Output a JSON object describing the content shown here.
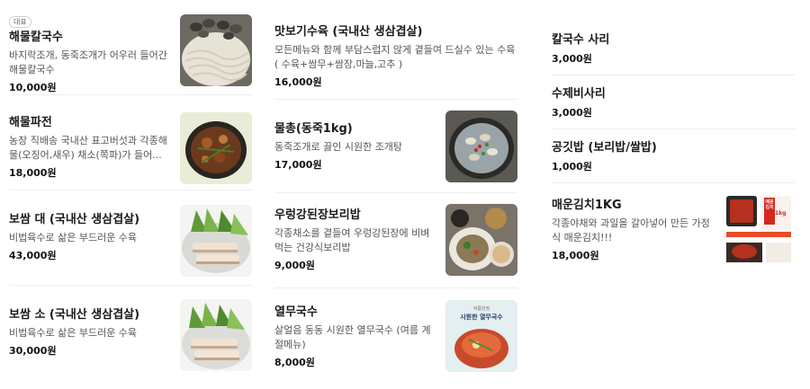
{
  "menu": {
    "col1": [
      {
        "badge": "대표",
        "name": "해물칼국수",
        "desc": "바지락조개, 동죽조개가 어우러 들어간 해물칼국수",
        "price": "10,000원",
        "thumb": "clam-noodle-photo"
      },
      {
        "name": "해물파전",
        "desc": "농장 직배송 국내산 표고버섯과 각종해물(오징어,새우) 채소(쪽파)가 들어...",
        "price": "18,000원",
        "thumb": "seafood-pancake-photo"
      },
      {
        "name": "보쌈 대 (국내산 생삼겹살)",
        "desc": "비법육수로 삶은 부드러운 수육",
        "price": "43,000원",
        "thumb": "bossam-large-photo"
      },
      {
        "name": "보쌈 소 (국내산 생삼겹살)",
        "desc": "비법육수로 삶은 부드러운 수육",
        "price": "30,000원",
        "thumb": "bossam-small-photo"
      }
    ],
    "col2": [
      {
        "name": "맛보기수육 (국내산 생삼겹살)",
        "desc": "모든메뉴와 함께 부담스럽지 않게 곁들여 드실수 있는 수육( 수육+쌈무+쌈장,마늘,고추 )",
        "price": "16,000원"
      },
      {
        "name": "물총(동죽1kg)",
        "desc": "동죽조개로 끓인 시원한 조개탕",
        "price": "17,000원",
        "thumb": "clam-soup-photo"
      },
      {
        "name": "우렁강된장보리밥",
        "desc": "각종채소를 곁들여 우렁강된장에 비벼먹는 건강식보리밥",
        "price": "9,000원",
        "thumb": "barley-rice-photo"
      },
      {
        "name": "열무국수",
        "desc": "살얼음 동동 시원한 열무국수 (여름 계절메뉴)",
        "price": "8,000원",
        "thumb": "yeolmu-noodle-photo",
        "thumb_text_small": "여름한정",
        "thumb_text": "시원한 열무국수"
      }
    ],
    "col3": [
      {
        "name": "칼국수 사리",
        "price": "3,000원"
      },
      {
        "name": "수제비사리",
        "price": "3,000원"
      },
      {
        "name": "공깃밥 (보리밥/쌀밥)",
        "price": "1,000원"
      },
      {
        "name": "매운김치1KG",
        "desc": "각종야채와 과일을 갈아넣어 만든 가정식 매운김치!!!",
        "price": "18,000원",
        "thumb": "kimchi-package-photo",
        "thumb_text": "매운김치",
        "thumb_text2": "1kg"
      }
    ]
  },
  "colors": {
    "text": "#1a1a1a",
    "desc": "#555555",
    "divider": "#eeeeee",
    "badge_border": "#cfcfcf"
  }
}
